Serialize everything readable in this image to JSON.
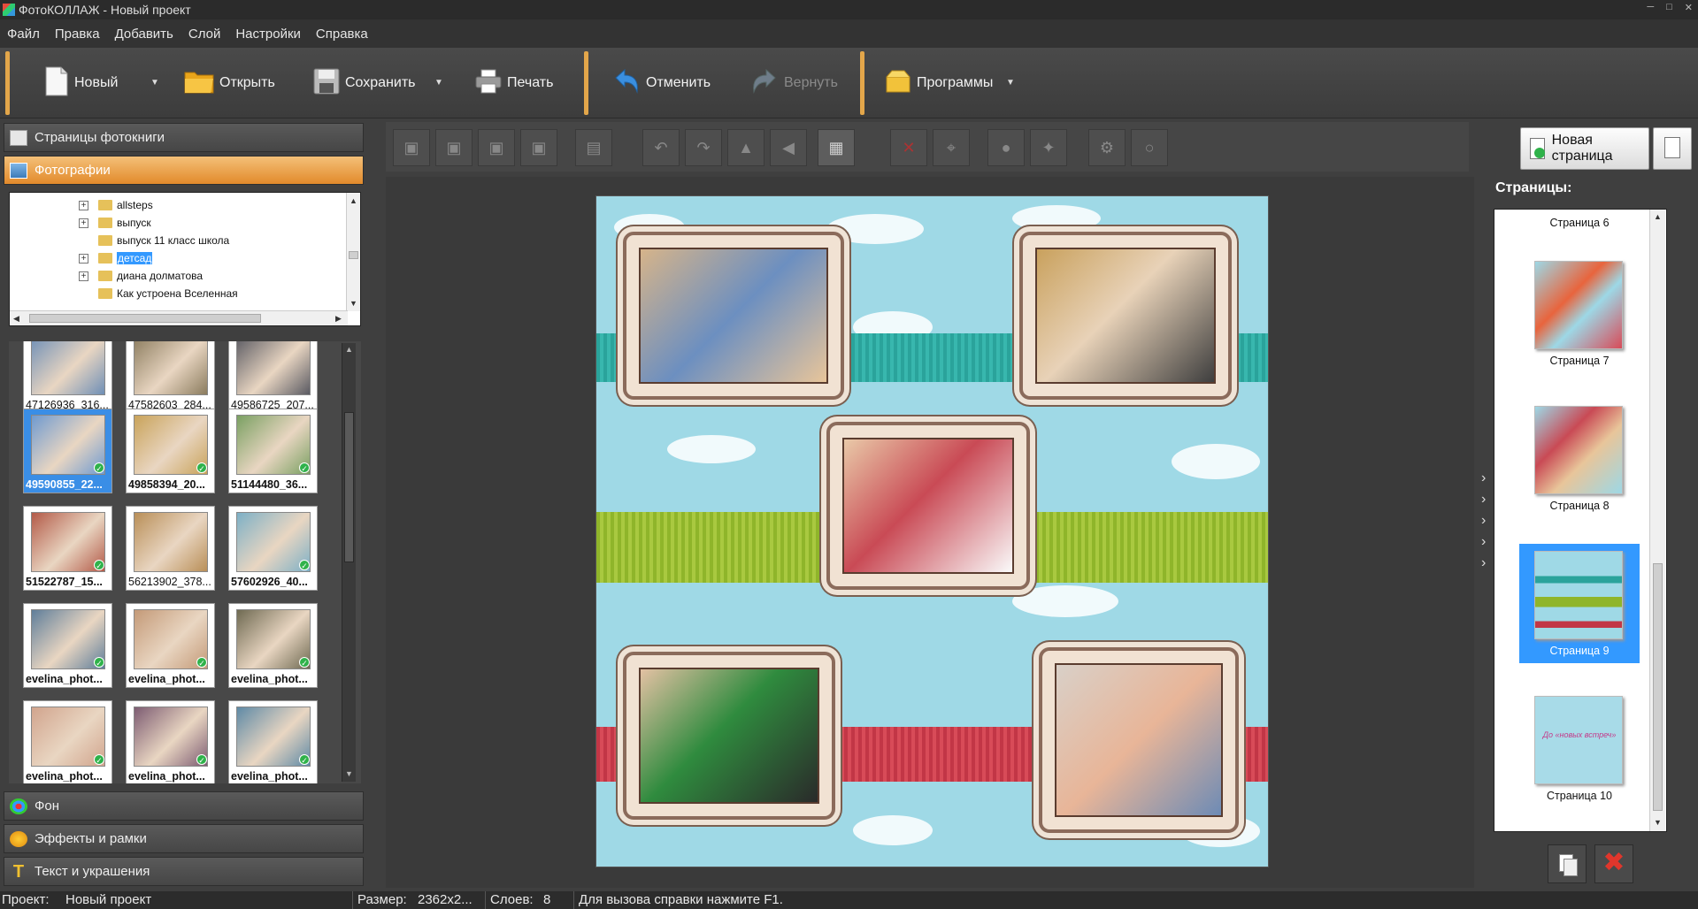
{
  "window": {
    "title": "ФотоКОЛЛАЖ - Новый проект"
  },
  "menu": [
    "Файл",
    "Правка",
    "Добавить",
    "Слой",
    "Настройки",
    "Справка"
  ],
  "toolbar": {
    "new_label": "Новый",
    "open_label": "Открыть",
    "save_label": "Сохранить",
    "print_label": "Печать",
    "undo_label": "Отменить",
    "redo_label": "Вернуть",
    "programs_label": "Программы"
  },
  "left_panel": {
    "photobook_pages": "Страницы фотокниги",
    "photos": "Фотографии",
    "background": "Фон",
    "effects": "Эффекты и рамки",
    "text": "Текст и украшения"
  },
  "tree": [
    {
      "label": "allsteps",
      "expandable": true,
      "selected": false
    },
    {
      "label": "выпуск",
      "expandable": true,
      "selected": false
    },
    {
      "label": "выпуск 11 класс школа",
      "expandable": false,
      "selected": false
    },
    {
      "label": "детсад",
      "expandable": true,
      "selected": true
    },
    {
      "label": "диана долматова",
      "expandable": true,
      "selected": false
    },
    {
      "label": "Как устроена Вселенная",
      "expandable": false,
      "selected": false
    }
  ],
  "thumbnails": [
    {
      "label": "47126936_316...",
      "checked": false,
      "selected": false,
      "bold": false,
      "color": "#6f8fb6"
    },
    {
      "label": "47582603_284...",
      "checked": false,
      "selected": false,
      "bold": false,
      "color": "#8b7c5e"
    },
    {
      "label": "49586725_207...",
      "checked": false,
      "selected": false,
      "bold": false,
      "color": "#5a5a62"
    },
    {
      "label": "49590855_22...",
      "checked": true,
      "selected": true,
      "bold": true,
      "color": "#6f9ad0"
    },
    {
      "label": "49858394_20...",
      "checked": true,
      "selected": false,
      "bold": true,
      "color": "#c9a35a"
    },
    {
      "label": "51144480_36...",
      "checked": true,
      "selected": false,
      "bold": true,
      "color": "#7aa062"
    },
    {
      "label": "51522787_15...",
      "checked": true,
      "selected": false,
      "bold": true,
      "color": "#b35a48"
    },
    {
      "label": "56213902_378...",
      "checked": false,
      "selected": false,
      "bold": false,
      "color": "#b98f58"
    },
    {
      "label": "57602926_40...",
      "checked": true,
      "selected": false,
      "bold": true,
      "color": "#7db0c6"
    },
    {
      "label": "evelina_phot...",
      "checked": true,
      "selected": false,
      "bold": true,
      "color": "#5f7e9a"
    },
    {
      "label": "evelina_phot...",
      "checked": true,
      "selected": false,
      "bold": true,
      "color": "#c49a78"
    },
    {
      "label": "evelina_phot...",
      "checked": true,
      "selected": false,
      "bold": true,
      "color": "#6f6a52"
    },
    {
      "label": "evelina_phot...",
      "checked": true,
      "selected": false,
      "bold": true,
      "color": "#d1a48d"
    },
    {
      "label": "evelina_phot...",
      "checked": true,
      "selected": false,
      "bold": true,
      "color": "#7d5c72"
    },
    {
      "label": "evelina_phot...",
      "checked": true,
      "selected": false,
      "bold": true,
      "color": "#5f8aa6"
    }
  ],
  "right_panel": {
    "new_page": "Новая страница",
    "pages_title": "Страницы:",
    "pages": [
      {
        "label": "Страница 6",
        "selected": false
      },
      {
        "label": "Страница 7",
        "selected": false
      },
      {
        "label": "Страница 8",
        "selected": false
      },
      {
        "label": "Страница 9",
        "selected": true
      },
      {
        "label": "Страница 10",
        "selected": false
      }
    ],
    "page10_text": "До «новых встреч»"
  },
  "status": {
    "project_label": "Проект:",
    "project_value": "Новый проект",
    "size_label": "Размер:",
    "size_value": "2362x2...",
    "layers_label": "Слоев:",
    "layers_value": "8",
    "help": "Для вызова справки нажмите F1."
  },
  "colors": {
    "accent": "#e28a2b",
    "selection": "#3399ff",
    "collage_bg": "#9fd9e6"
  }
}
